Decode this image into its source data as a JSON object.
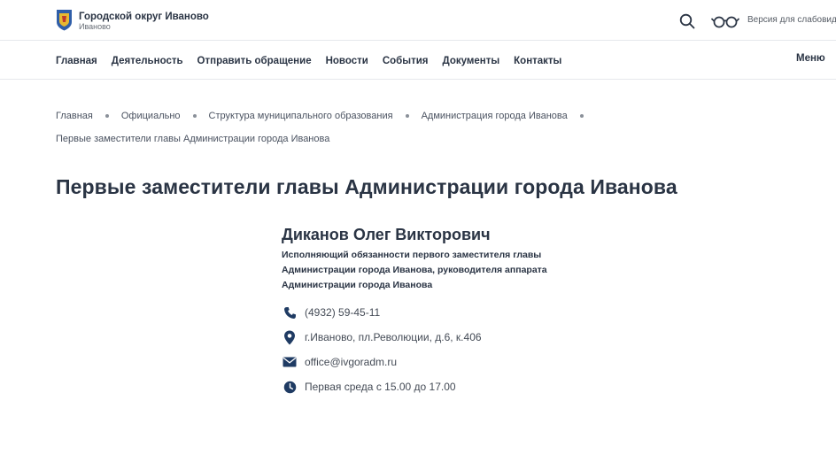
{
  "header": {
    "brand_title": "Городской округ Иваново",
    "brand_subtitle": "Иваново",
    "accessible_version": "Версия для слабовидящих"
  },
  "nav": {
    "items": [
      "Главная",
      "Деятельность",
      "Отправить обращение",
      "Новости",
      "События",
      "Документы",
      "Контакты"
    ],
    "menu_label": "Меню"
  },
  "breadcrumb": {
    "items": [
      "Главная",
      "Официально",
      "Структура муниципального образования",
      "Администрация города Иванова",
      "Первые заместители главы Администрации города Иванова"
    ]
  },
  "page": {
    "title": "Первые заместители главы Администрации города Иванова"
  },
  "person": {
    "name": "Диканов Олег Викторович",
    "position": "Исполняющий обязанности первого заместителя главы Администрации города Иванова, руководителя аппарата Администрации города Иванова",
    "phone": "(4932) 59-45-11",
    "address": "г.Иваново, пл.Революции, д.6, к.406",
    "email": "office@ivgoradm.ru",
    "hours": "Первая среда с 15.00 до 17.00"
  },
  "colors": {
    "text": "#2a3444",
    "icon": "#1f3b63",
    "logo_blue": "#2f5ea8",
    "logo_yellow": "#e8b830"
  }
}
